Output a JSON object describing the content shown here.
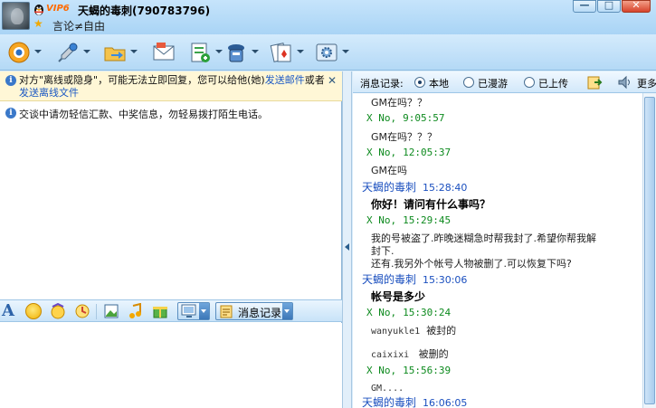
{
  "title_bar": {
    "vip_label": "VIP6",
    "nickname": "天蝎的毒刺(790783796)",
    "signature": "言论≠自由",
    "minimize_glyph": "—",
    "maximize_glyph": "□",
    "close_glyph": "✕"
  },
  "toolbar": {
    "icons": [
      "video-icon",
      "microphone-icon",
      "folder-transfer-icon",
      "mail-icon",
      "sms-icon",
      "mobile-icon",
      "game-icon",
      "settings-icon"
    ]
  },
  "notice": {
    "text_a": "对方\"离线或隐身\"，可能无法立即回复，您可以给他(她)",
    "link_mail": "发送邮件",
    "text_b": "或者",
    "link_file": "发送离线文件",
    "close_glyph": "✕"
  },
  "warning": {
    "text": "交谈中请勿轻信汇款、中奖信息，勿轻易拨打陌生电话。"
  },
  "format_bar": {
    "font_label": "A",
    "msg_record_label": "消息记录"
  },
  "history_bar": {
    "title": "消息记录:",
    "options": [
      {
        "label": "本地",
        "selected": true
      },
      {
        "label": "已漫游",
        "selected": false
      },
      {
        "label": "已上传",
        "selected": false
      }
    ],
    "more_label": "更多"
  },
  "messages": [
    {
      "kind": "body",
      "text": "GM在吗？？"
    },
    {
      "kind": "meta",
      "sender": "X  No,",
      "time": "9:05:57"
    },
    {
      "kind": "body",
      "text": "GM在吗？？？"
    },
    {
      "kind": "meta",
      "sender": "X  No,",
      "time": "12:05:37"
    },
    {
      "kind": "body",
      "text": "GM在吗"
    },
    {
      "kind": "me",
      "sender": "天蝎的毒刺",
      "time": "15:28:40"
    },
    {
      "kind": "bold",
      "text": "你好！请问有什么事吗？"
    },
    {
      "kind": "meta",
      "sender": "X  No,",
      "time": "15:29:45"
    },
    {
      "kind": "body",
      "text": "我的号被盗了.昨晚迷糊急时帮我封了.希望你帮我解"
    },
    {
      "kind": "body",
      "text": "封下."
    },
    {
      "kind": "body",
      "text": "还有.我另外个帐号人物被删了.可以恢复下吗?"
    },
    {
      "kind": "me",
      "sender": "天蝎的毒刺",
      "time": "15:30:06"
    },
    {
      "kind": "bold",
      "text": "帐号是多少"
    },
    {
      "kind": "meta",
      "sender": "X  No,",
      "time": "15:30:24"
    },
    {
      "kind": "pair",
      "a": "wanyukle1",
      "b": "被封的"
    },
    {
      "kind": "pair",
      "a": "caixixi",
      "b": "被删的"
    },
    {
      "kind": "meta",
      "sender": "X  No,",
      "time": "15:56:39"
    },
    {
      "kind": "mono",
      "text": "GM...."
    },
    {
      "kind": "me",
      "sender": "天蝎的毒刺",
      "time": "16:06:05"
    }
  ]
}
